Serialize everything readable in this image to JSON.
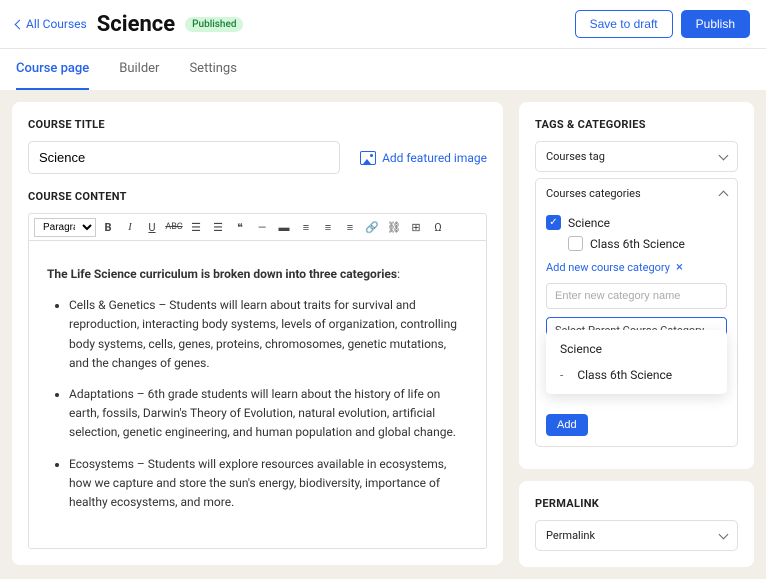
{
  "header": {
    "back_label": "All Courses",
    "title": "Science",
    "status_badge": "Published",
    "save_draft": "Save to draft",
    "publish": "Publish"
  },
  "tabs": [
    {
      "label": "Course page",
      "active": true
    },
    {
      "label": "Builder",
      "active": false
    },
    {
      "label": "Settings",
      "active": false
    }
  ],
  "course_title": {
    "label": "COURSE TITLE",
    "value": "Science",
    "featured_image_label": "Add featured image"
  },
  "course_content": {
    "label": "COURSE CONTENT",
    "format_selector": "Paragraph",
    "intro": "The Life Science curriculum is broken down into three categories",
    "items": [
      "Cells & Genetics – Students will learn about traits for survival and reproduction, interacting body systems, levels of organization, controlling body systems, cells, genes, proteins, chromosomes, genetic mutations, and the changes of genes.",
      "Adaptations – 6th grade students will learn about the history of life on earth, fossils, Darwin's Theory of Evolution, natural evolution, artificial selection, genetic engineering, and human population and global change.",
      "Ecosystems – Students will explore resources available in ecosystems, how we capture and store the sun's energy, biodiversity, importance of healthy ecosystems, and more."
    ]
  },
  "sidebar": {
    "tags_label": "TAGS & CATEGORIES",
    "courses_tag_label": "Courses tag",
    "courses_categories_label": "Courses categories",
    "categories": [
      {
        "label": "Science",
        "checked": true
      },
      {
        "label": "Class 6th Science",
        "checked": false,
        "child": true
      }
    ],
    "add_new_label": "Add new course category",
    "new_category_placeholder": "Enter new category name",
    "parent_select_placeholder": "Select Parent Course Category",
    "dropdown_options": [
      {
        "label": "Science"
      },
      {
        "label": "Class 6th Science",
        "child": true
      }
    ],
    "add_button": "Add",
    "permalink_label": "PERMALINK",
    "permalink_value": "Permalink"
  }
}
